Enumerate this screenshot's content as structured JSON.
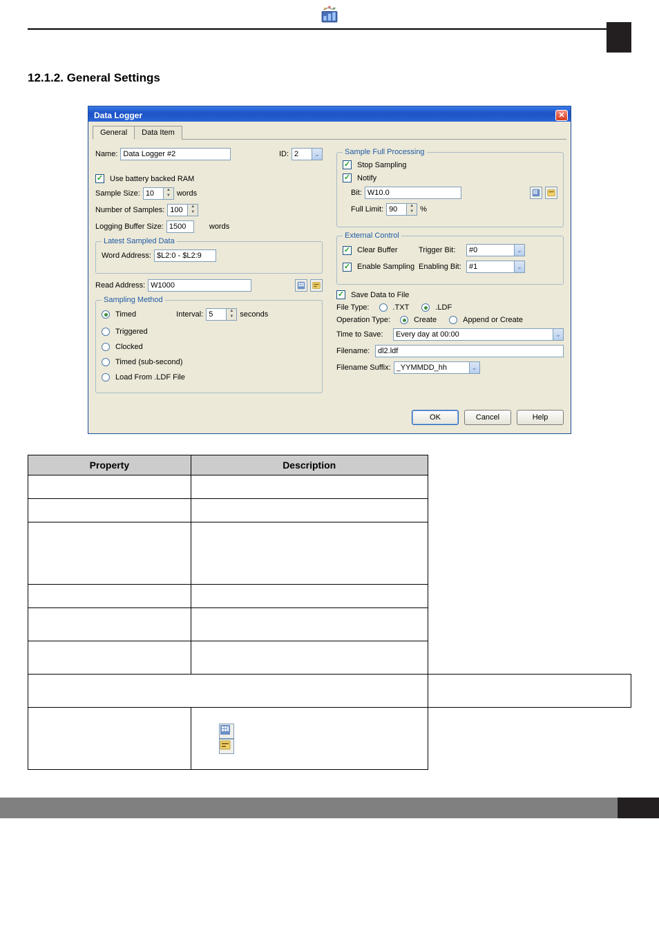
{
  "section_heading": "12.1.2. General Settings",
  "dialog": {
    "title": "Data Logger",
    "tabs": {
      "general": "General",
      "data_item": "Data Item"
    },
    "name_label": "Name:",
    "name_value": "Data Logger #2",
    "id_label": "ID:",
    "id_value": "2",
    "use_ram": "Use battery backed RAM",
    "sample_size_label": "Sample Size:",
    "sample_size_value": "10",
    "sample_size_unit": "words",
    "number_samples_label": "Number of Samples:",
    "number_samples_value": "100",
    "logging_buffer_label": "Logging Buffer Size:",
    "logging_buffer_value": "1500",
    "logging_buffer_unit": "words",
    "latest_sampled_legend": "Latest Sampled Data",
    "word_address_label": "Word Address:",
    "word_address_value": "$L2:0 - $L2:9",
    "read_address_label": "Read Address:",
    "read_address_value": "W1000",
    "sampling_method_legend": "Sampling Method",
    "timed": "Timed",
    "interval_label": "Interval:",
    "interval_value": "5",
    "interval_unit": "seconds",
    "triggered": "Triggered",
    "clocked": "Clocked",
    "timed_sub": "Timed (sub-second)",
    "load_ldf": "Load From .LDF File",
    "sample_full_legend": "Sample Full Processing",
    "stop_sampling": "Stop Sampling",
    "notify": "Notify",
    "bit_label": "Bit:",
    "bit_value": "W10.0",
    "full_limit_label": "Full Limit:",
    "full_limit_value": "90",
    "full_limit_unit": "%",
    "external_control_legend": "External Control",
    "clear_buffer": "Clear Buffer",
    "trigger_bit_label": "Trigger Bit:",
    "trigger_bit_value": "#0",
    "enable_sampling": "Enable Sampling",
    "enabling_bit_label": "Enabling Bit:",
    "enabling_bit_value": "#1",
    "save_data": "Save Data to File",
    "file_type_label": "File Type:",
    "file_type_txt": ".TXT",
    "file_type_ldf": ".LDF",
    "operation_type_label": "Operation Type:",
    "op_create": "Create",
    "op_append": "Append or Create",
    "time_to_save_label": "Time to Save:",
    "time_to_save_value": "Every day at 00:00",
    "filename_label": "Filename:",
    "filename_value": "dl2.ldf",
    "filename_suffix_label": "Filename Suffix:",
    "filename_suffix_value": "_YYMMDD_hh",
    "ok": "OK",
    "cancel": "Cancel",
    "help": "Help"
  },
  "table": {
    "col_property": "Property",
    "col_description": "Description"
  }
}
